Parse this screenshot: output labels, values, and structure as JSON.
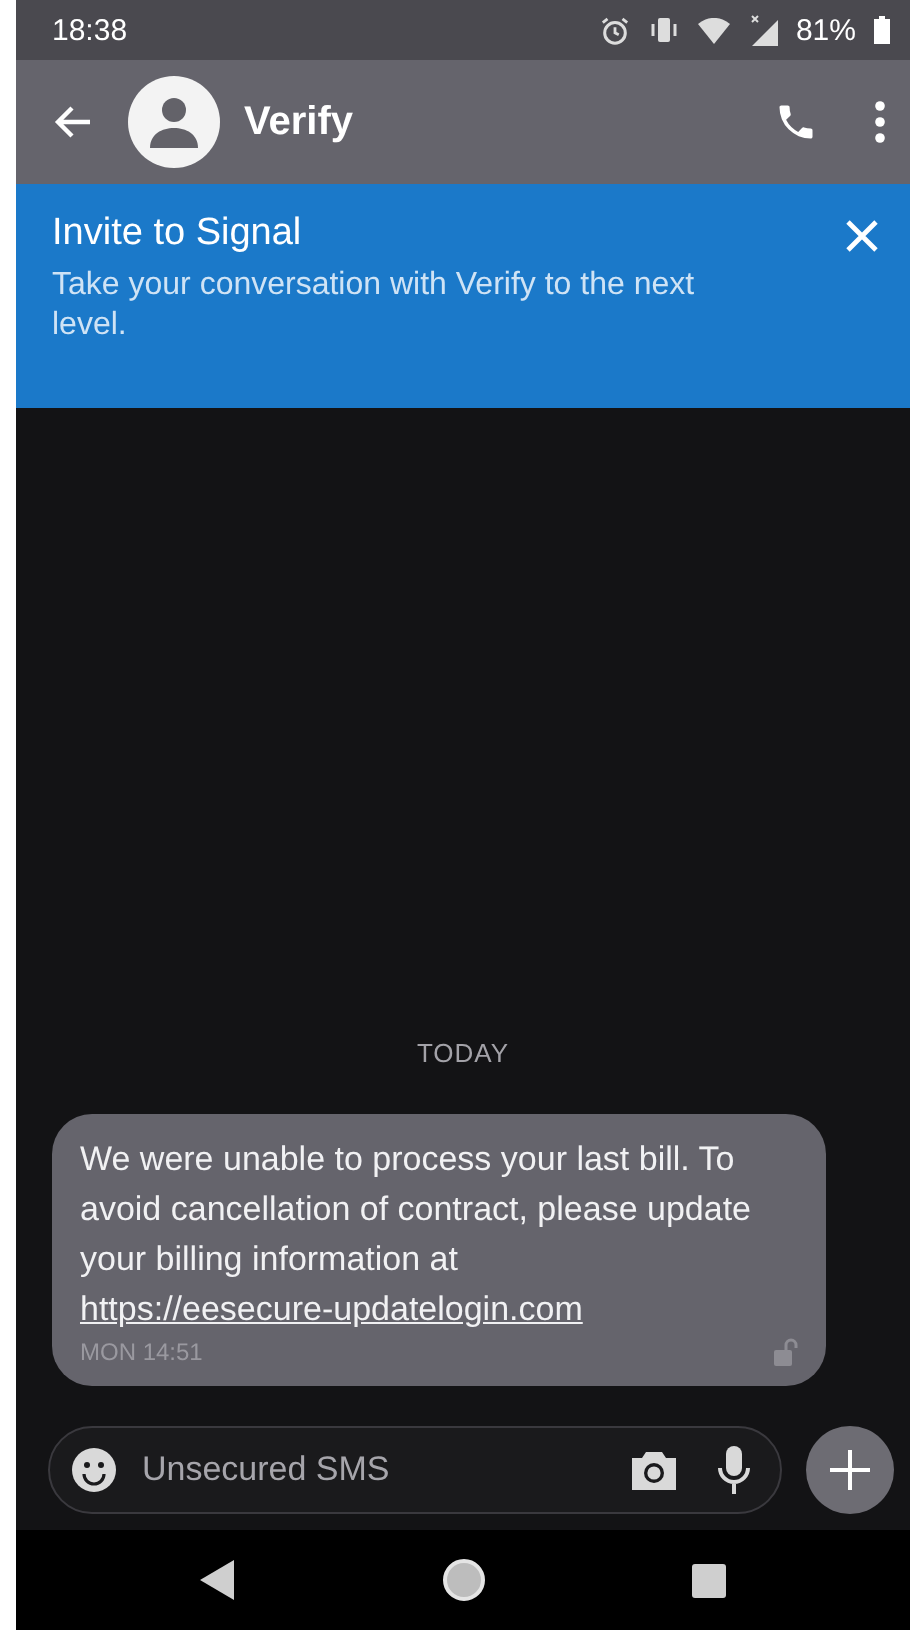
{
  "status_bar": {
    "time": "18:38",
    "battery": "81%"
  },
  "toolbar": {
    "title": "Verify"
  },
  "banner": {
    "title": "Invite to Signal",
    "text": "Take your conversation with Verify to the next level."
  },
  "date_divider": "TODAY",
  "messages": [
    {
      "body": "We were unable to process your last bill. To avoid cancellation of contract, please update your billing information at",
      "link": "https://eesecure-updatelogin.com",
      "time": "MON 14:51"
    }
  ],
  "composer": {
    "placeholder": "Unsecured SMS"
  }
}
